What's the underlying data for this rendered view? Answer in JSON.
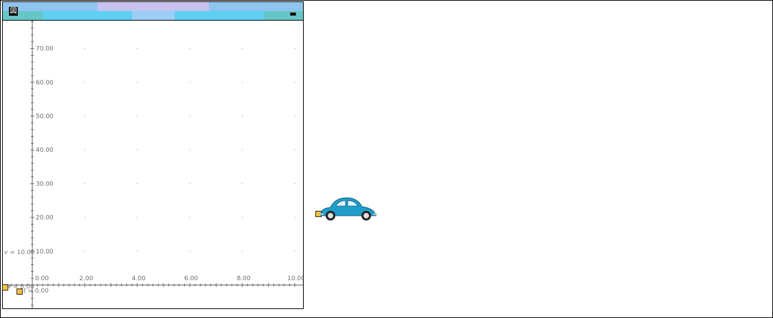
{
  "window": {
    "icon": "graph-app-icon",
    "minimize_icon": "minimize-icon"
  },
  "graph": {
    "x_ticks": [
      "0.00",
      "2.00",
      "4.00",
      "6.00",
      "8.00",
      "10.00"
    ],
    "y_ticks": [
      "10.00",
      "20.00",
      "30.00",
      "40.00",
      "50.00",
      "60.00",
      "70.00"
    ]
  },
  "readouts": {
    "v_var": "v",
    "v_text": " = 10.00",
    "x_var": "x",
    "x_text": " = 0.00",
    "t_var": "t",
    "t_text": " = 0.00"
  },
  "colors": {
    "handle": "#f6c23a",
    "car_body": "#1f9ec9",
    "titlebar_cyan": "#5fd0e8",
    "titlebar_lavender": "#c8c2f0"
  }
}
